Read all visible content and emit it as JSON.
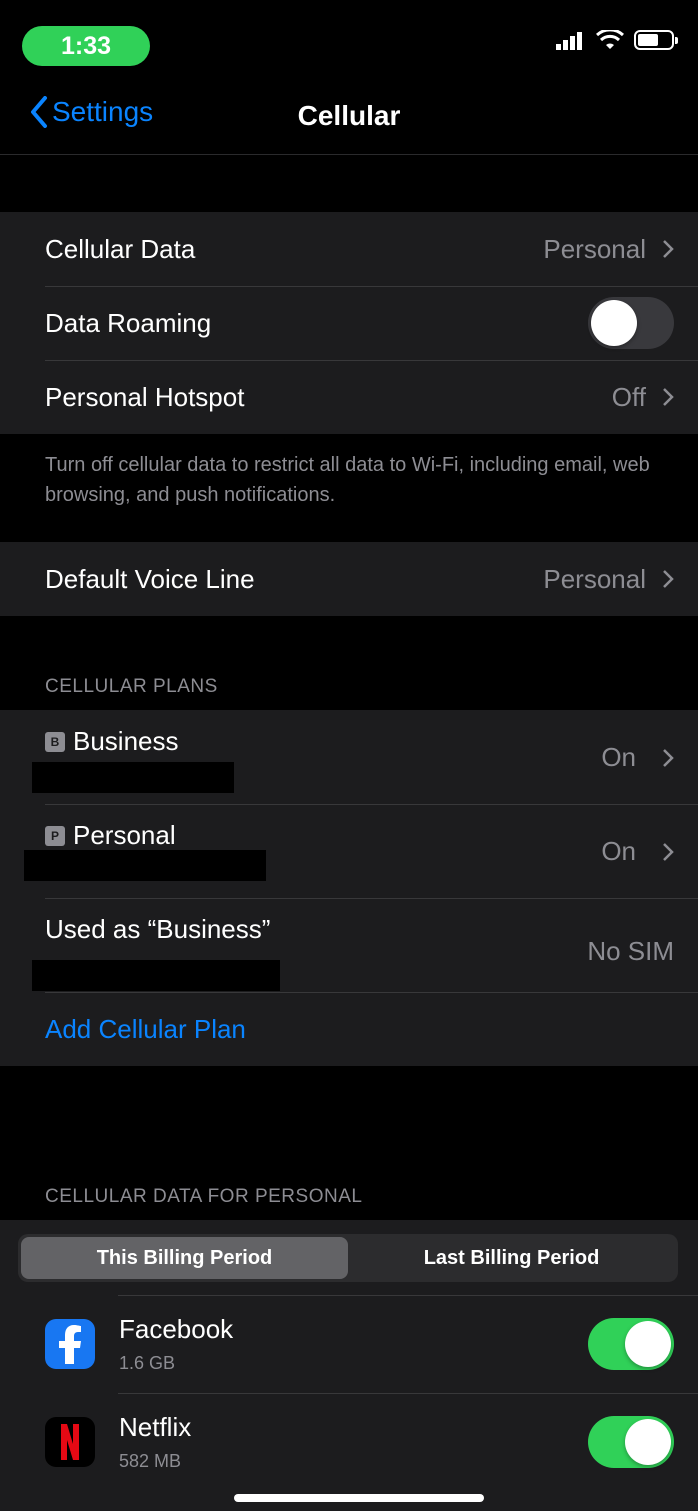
{
  "status_bar": {
    "time": "1:33"
  },
  "nav": {
    "back_label": "Settings",
    "title": "Cellular"
  },
  "group1": {
    "cellular_data": {
      "label": "Cellular Data",
      "value": "Personal"
    },
    "data_roaming": {
      "label": "Data Roaming",
      "enabled": false
    },
    "personal_hotspot": {
      "label": "Personal Hotspot",
      "value": "Off"
    },
    "footer": "Turn off cellular data to restrict all data to Wi-Fi, including email, web browsing, and push notifications."
  },
  "default_voice_line": {
    "label": "Default Voice Line",
    "value": "Personal"
  },
  "cellular_plans": {
    "header": "CELLULAR PLANS",
    "plans": [
      {
        "badge": "B",
        "name": "Business",
        "value": "On"
      },
      {
        "badge": "P",
        "name": "Personal",
        "value": "On"
      },
      {
        "name": "Used as “Business”",
        "value": "No SIM"
      }
    ],
    "add_plan_label": "Add Cellular Plan"
  },
  "cellular_data_section": {
    "header": "CELLULAR DATA FOR PERSONAL",
    "tabs": [
      "This Billing Period",
      "Last Billing Period"
    ],
    "active_tab": 0,
    "apps": [
      {
        "name": "Facebook",
        "usage": "1.6 GB",
        "enabled": true,
        "icon": "facebook-icon",
        "icon_color": "#1877f2"
      },
      {
        "name": "Netflix",
        "usage": "582 MB",
        "enabled": true,
        "icon": "netflix-icon",
        "icon_color": "#000000"
      }
    ]
  },
  "colors": {
    "accent": "#0a84ff",
    "toggle_on": "#30d158",
    "time_pill": "#30d158"
  }
}
